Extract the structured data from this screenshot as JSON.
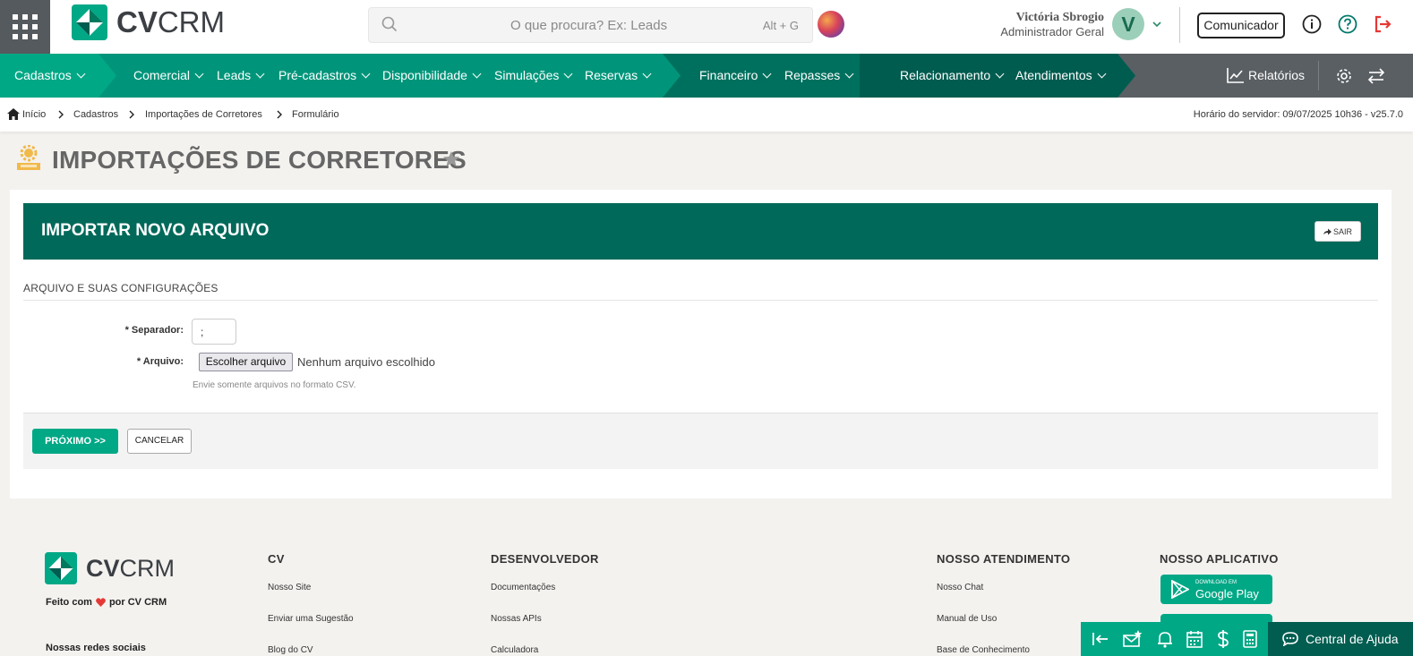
{
  "header": {
    "brand": {
      "bold": "CV",
      "light": "CRM"
    },
    "search": {
      "placeholder": "O que procura? Ex: Leads",
      "shortcut": "Alt + G"
    },
    "user": {
      "name": "Victória Sbrogio",
      "role": "Administrador Geral",
      "initial": "V"
    },
    "communicator_label": "Comunicador"
  },
  "nav": {
    "items": [
      "Cadastros",
      "Comercial",
      "Leads",
      "Pré-cadastros",
      "Disponibilidade",
      "Simulações",
      "Reservas",
      "Financeiro",
      "Repasses",
      "Relacionamento",
      "Atendimentos"
    ],
    "reports_label": "Relatórios"
  },
  "breadcrumb": {
    "items": [
      "Início",
      "Cadastros",
      "Importações de Corretores",
      "Formulário"
    ],
    "server_time": "Horário do servidor: 09/07/2025 10h36 - v25.7.0"
  },
  "page": {
    "title": "IMPORTAÇÕES DE CORRETORES"
  },
  "form": {
    "banner_title": "IMPORTAR NOVO ARQUIVO",
    "exit_label": "SAIR",
    "section_title": "ARQUIVO E SUAS CONFIGURAÇÕES",
    "separator_label": "Separador:",
    "separator_value": ";",
    "file_label": "Arquivo:",
    "required_mark": "*",
    "file_button": "Escolher arquivo",
    "file_status": "Nenhum arquivo escolhido",
    "hint": "Envie somente arquivos no formato CSV.",
    "next_label": "PRÓXIMO >>",
    "cancel_label": "CANCELAR"
  },
  "footer": {
    "made_with_prefix": "Feito com",
    "made_with_suffix": "por CV CRM",
    "social_title": "Nossas redes sociais",
    "columns": [
      {
        "title": "CV",
        "links": [
          "Nosso Site",
          "Enviar uma Sugestão",
          "Blog do CV"
        ]
      },
      {
        "title": "DESENVOLVEDOR",
        "links": [
          "Documentações",
          "Nossas APIs",
          "Calculadora"
        ]
      },
      {
        "title": "NOSSO ATENDIMENTO",
        "links": [
          "Nosso Chat",
          "Manual de Uso",
          "Base de Conhecimento"
        ]
      },
      {
        "title": "NOSSO APLICATIVO",
        "links": []
      }
    ],
    "google_play_small": "DOWNLOAD EM",
    "google_play_big": "Google Play"
  },
  "help_label": "Central de Ajuda",
  "colors": {
    "brand_green": "#00a886",
    "dark_green": "#00695a",
    "nav_dark": "#007a63",
    "logout_red": "#e53935"
  }
}
